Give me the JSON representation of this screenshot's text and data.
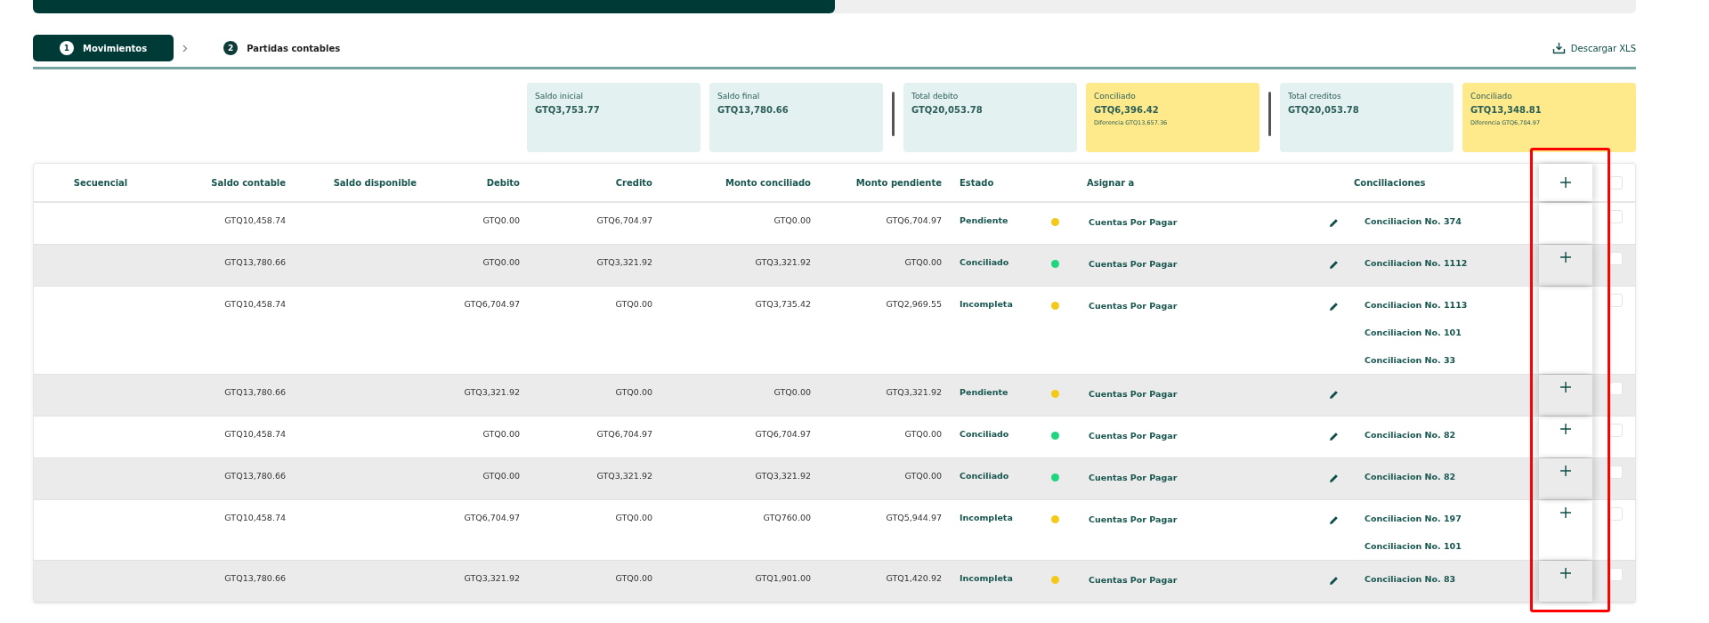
{
  "steps": [
    {
      "number": "1",
      "label": "Movimientos",
      "selected": true
    },
    {
      "number": "2",
      "label": "Partidas contables",
      "selected": false
    }
  ],
  "progress": {
    "level": 0.5
  },
  "download": {
    "label": "Descargar XLS"
  },
  "summary_groups": [
    [
      {
        "label": "Saldo inicial",
        "value": "GTQ3,753.77",
        "highlight": false
      },
      {
        "label": "Saldo final",
        "value": "GTQ13,780.66",
        "highlight": false
      }
    ],
    [
      {
        "label": "Total debito",
        "value": "GTQ20,053.78",
        "highlight": false
      },
      {
        "label": "Conciliado",
        "value": "GTQ6,396.42",
        "note": "Diferencia GTQ13,657.36",
        "highlight": true
      }
    ],
    [
      {
        "label": "Total creditos",
        "value": "GTQ20,053.78",
        "highlight": false
      },
      {
        "label": "Conciliado",
        "value": "GTQ13,348.81",
        "note": "Diferencia GTQ6,704.97",
        "highlight": true
      }
    ]
  ],
  "table": {
    "columns": [
      "Secuencial",
      "Saldo contable",
      "Saldo disponible",
      "Debito",
      "Credito",
      "Monto conciliado",
      "Monto pendiente",
      "Estado",
      "Asignar a",
      "Conciliaciones"
    ],
    "header_checked": false,
    "rows": [
      {
        "saldo_contable": "GTQ10,458.74",
        "debito": "GTQ0.00",
        "credito": "GTQ6,704.97",
        "monto_conciliado": "GTQ0.00",
        "monto_pendiente": "GTQ6,704.97",
        "estado": "Pendiente",
        "color": "#f5c91a",
        "asignar": "Cuentas Por Pagar",
        "conciliaciones": [
          "Conciliacion No. 374"
        ],
        "add_button": false,
        "checked": false
      },
      {
        "saldo_contable": "GTQ13,780.66",
        "debito": "GTQ0.00",
        "credito": "GTQ3,321.92",
        "monto_conciliado": "GTQ3,321.92",
        "monto_pendiente": "GTQ0.00",
        "estado": "Conciliado",
        "color": "#1fd67e",
        "asignar": "Cuentas Por Pagar",
        "conciliaciones": [
          "Conciliacion No. 1112"
        ],
        "add_button": true,
        "checked": false
      },
      {
        "saldo_contable": "GTQ10,458.74",
        "debito": "GTQ6,704.97",
        "credito": "GTQ0.00",
        "monto_conciliado": "GTQ3,735.42",
        "monto_pendiente": "GTQ2,969.55",
        "estado": "Incompleta",
        "color": "#f5c91a",
        "asignar": "Cuentas Por Pagar",
        "conciliaciones": [
          "Conciliacion No. 1113",
          "Conciliacion No. 101",
          "Conciliacion No. 33"
        ],
        "add_button": false,
        "checked": false
      },
      {
        "saldo_contable": "GTQ13,780.66",
        "debito": "GTQ3,321.92",
        "credito": "GTQ0.00",
        "monto_conciliado": "GTQ0.00",
        "monto_pendiente": "GTQ3,321.92",
        "estado": "Pendiente",
        "color": "#f5c91a",
        "asignar": "Cuentas Por Pagar",
        "conciliaciones": [],
        "add_button": true,
        "checked": false
      },
      {
        "saldo_contable": "GTQ10,458.74",
        "debito": "GTQ0.00",
        "credito": "GTQ6,704.97",
        "monto_conciliado": "GTQ6,704.97",
        "monto_pendiente": "GTQ0.00",
        "estado": "Conciliado",
        "color": "#1fd67e",
        "asignar": "Cuentas Por Pagar",
        "conciliaciones": [
          "Conciliacion No. 82"
        ],
        "add_button": true,
        "checked": false
      },
      {
        "saldo_contable": "GTQ13,780.66",
        "debito": "GTQ0.00",
        "credito": "GTQ3,321.92",
        "monto_conciliado": "GTQ3,321.92",
        "monto_pendiente": "GTQ0.00",
        "estado": "Conciliado",
        "color": "#1fd67e",
        "asignar": "Cuentas Por Pagar",
        "conciliaciones": [
          "Conciliacion No. 82"
        ],
        "add_button": true,
        "checked": false
      },
      {
        "saldo_contable": "GTQ10,458.74",
        "debito": "GTQ6,704.97",
        "credito": "GTQ0.00",
        "monto_conciliado": "GTQ760.00",
        "monto_pendiente": "GTQ5,944.97",
        "estado": "Incompleta",
        "color": "#f5c91a",
        "asignar": "Cuentas Por Pagar",
        "conciliaciones": [
          "Conciliacion No. 197",
          "Conciliacion No. 101"
        ],
        "add_button": true,
        "checked": false
      },
      {
        "saldo_contable": "GTQ13,780.66",
        "debito": "GTQ3,321.92",
        "credito": "GTQ0.00",
        "monto_conciliado": "GTQ1,901.00",
        "monto_pendiente": "GTQ1,420.92",
        "estado": "Incompleta",
        "color": "#f5c91a",
        "asignar": "Cuentas Por Pagar",
        "conciliaciones": [
          "Conciliacion No. 83"
        ],
        "add_button": true,
        "checked": false
      }
    ]
  }
}
